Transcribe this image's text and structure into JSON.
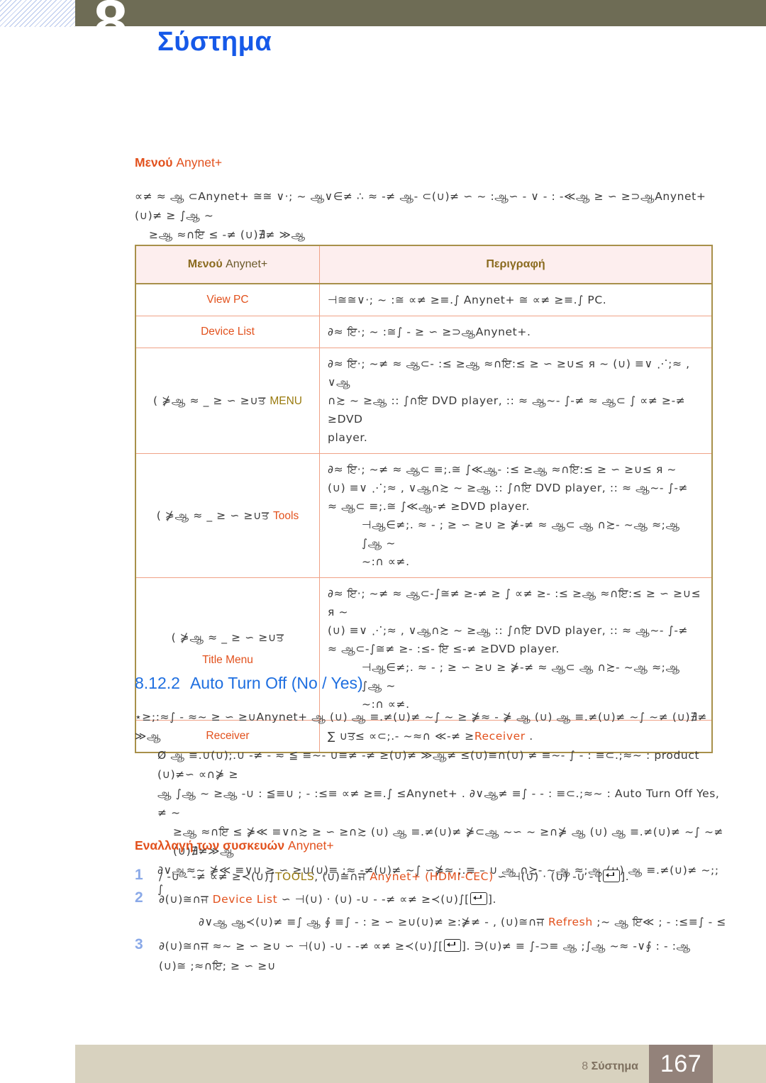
{
  "header": {
    "chapter_number": "8",
    "chapter_title": "Σύστημα"
  },
  "sections": {
    "anynet_menu_heading_bold": "Μενού",
    "anynet_menu_heading_rest": " Anynet+",
    "anynet_menu_intro_line1": "∝≠  ≈  ஆ ⊂Anynet+   ≅≅ ∨·;  ~  ஆ∨∈≠ ∴   ≈  -≠ ஆ- ⊂(∪)≠  ∽  ~  :ஆ∽ - ∨  -      : -≪ஆ   ≥  ∽  ≥⊃ஆAnynet+  (∪)≠  ≥   ∫ஆ  ~",
    "anynet_menu_intro_line2": "≥ஆ      ≈∩ਇ  ≤  -≠ (∪)∄≠ ≫ஆ",
    "auto_turn_off_number": "8.12.2",
    "auto_turn_off_title": "Auto Turn Off (No / Yes)",
    "auto_turn_off_para": "⋆≥;:≈∫ -   ≈~   ≥ ∽ ≥∪Anynet+  ஆ   (∪) ஆ ≡.≠(∪)≠ ~∫  ~  ≥ ⋡≈ -   ⋡  ஆ (∪) ஆ ≡.≠(∪)≠ ~∫   ~≠ (∪)∄≠ ≫ஆ",
    "note_line1": "Ø  ஆ ≡.∪(∪);.∪  -≠ -  ≂  ≦  ≡~- ∪≡≠ -≠ ≥(∪)≠ ≫ஆ≠ ≤(∪)≡∩(∪)  ≠ ≡~-  ∫  - : ≡⊂.;≈~ : product (∪)≠∽ ∝∩⋡ ≥",
    "note_line2": "ஆ   ∫ஆ ~ ≥ஆ -∪ : ≦≡∪  ; - :≤≡  ∝≠ ≥≡.∫  ≤Anynet+ .  ∂∨ஆ≠ ≡∫  - - : ≡⊂.;≈~ : Auto Turn Off      Yes, ≠ ~",
    "note_line3": "≥ஆ      ≈∩ਇ ≤  ⋡≪  ≡∨∩≿  ≥ ∽ ≥∩≿ (∪) ஆ ≡.≠(∪)≠ ⋡⊂ஆ  ~∽ ~ ≥∩⋡  ஆ (∪) ஆ ≡.≠(∪)≠ ~∫   ~≠ (∪)∄≠≫ஆ",
    "note_line4": "∂∨ஆ≈~  ⋡≪  ≡∨∪  ≥ ∽ ≥∪(∪)≡  ;≈ -≠(∪)≠ ~∫  ∽⋡≈    ;.≡ – ∪   ஆ ∩≿-  ~ஆ  ≈;ஆ (∪) ஆ ≡.≠(∪)≠ ~;;  ∫",
    "switch_heading_bold": "Εναλλαγή των συσκευών",
    "switch_heading_rest": " Anynet+"
  },
  "table": {
    "header_menu_bold": "Μενού",
    "header_menu_rest": " Anynet+",
    "header_description": "Περιγραφή",
    "rows": [
      {
        "label": "View PC",
        "label_pre": "",
        "label_accent": "",
        "label_accent_color": "",
        "desc": "⊣≅≅∨·; ~ :≅  ∝≠ ≥≡.∫  Anynet+     ≅  ∝≠ ≥≡.∫  PC."
      },
      {
        "label": "Device List",
        "label_pre": "",
        "label_accent": "",
        "desc": "∂≈   ਇ·; ~ :≅∫ -     ≥ ∽ ≥⊃ஆAnynet+."
      },
      {
        "label_pre": "( ⋡ஆ ≈ _  ≥ ∽ ≥∪ਤ ",
        "label_accent": "MENU",
        "label_accent_color": "gold",
        "label": "",
        "desc_line1": "∂≈   ਇ·; ~≠ ≈ ஆ⊂- :≤  ≥ஆ      ≈∩ਇ:≤  ≥ ∽ ≥∪≤ я ~ (∪)  ≡∨   ⋰;≈ ,    ∨ஆ",
        "desc_line2": "∩≿ ~ ≥ஆ  :: ∫∩ਇ  DVD player, ::    ≈   ஆ~-  ∫-≠ ≈ ஆ⊂  ∫  ∝≠ ≥-≠ ≥DVD",
        "desc_line3": "player."
      },
      {
        "label_pre": "( ⋡ஆ ≈ _  ≥ ∽ ≥∪ਤ ",
        "label_accent": "Tools",
        "label_accent_color": "orange",
        "label": "",
        "desc_line1": "∂≈   ਇ·; ~≠ ≈ ஆ⊂ ≡;.≅ ∫≪ஆ- :≤  ≥ஆ      ≈∩ਇ:≤  ≥ ∽ ≥∪≤ я ~",
        "desc_line2": "(∪)  ≡∨   ⋰;≈ ,  ∨ஆ∩≿ ~ ≥ஆ  :: ∫∩ਇ  DVD player, ::    ≈   ஆ~-  ∫-≠",
        "desc_line3": "≈ ஆ⊂ ≡;.≅ ∫≪ஆ-≠ ≥DVD player.",
        "desc_note1": "⊣ஆ∈≠;.  ≈ - ;  ≥ ∽ ≥∪  ≥ ⋡-≠ ≈ ஆ⊂ ஆ ∩≿-  ~ஆ  ≈;ஆ ∫ஆ ~",
        "desc_note2": "~:∩ ∝≠."
      },
      {
        "label_pre": "( ⋡ஆ ≈ _  ≥ ∽ ≥∪ਤ",
        "label_accent": "Title Menu",
        "label_accent_color": "orange",
        "label": "",
        "desc_line1": "∂≈   ਇ·; ~≠ ≈ ஆ⊂-∫≅≠ ≥-≠ ≥  ∫ ∝≠ ≥- :≤  ≥ஆ      ≈∩ਇ:≤  ≥ ∽ ≥∪≤ я ~",
        "desc_line2": "(∪)  ≡∨   ⋰;≈ ,  ∨ஆ∩≿ ~ ≥ஆ  :: ∫∩ਇ  DVD player, ::    ≈   ஆ~-  ∫-≠",
        "desc_line3": "≈ ஆ⊂-∫≅≠ ≥- :≤-  ਇ  ≤-≠ ≥DVD player.",
        "desc_note1": "⊣ஆ∈≠;.  ≈ - ;  ≥ ∽ ≥∪  ≥ ⋡-≠ ≈ ஆ⊂ ஆ ∩≿-  ~ஆ  ≈;ஆ ∫ஆ ~",
        "desc_note2": "~:∩ ∝≠."
      },
      {
        "label": "Receiver",
        "label_pre": "",
        "label_accent": "",
        "desc_pre": "∑ ∪ਤ≤ ∝⊂;.-  ~≈∩ ≪-≠ ≥",
        "desc_accent": "Receiver",
        "desc_post": " ."
      }
    ]
  },
  "steps": [
    {
      "number": "1",
      "pre": "/ -∪ -  -≠ ∝≠ ≥≺(∪)∫",
      "accent1": "TOOLS",
      "accent1_color": "gold",
      "mid": ",  (∪)≅∩ਜ  ",
      "accent2": "Anynet+ (HDMI-CEC)",
      "accent2_color": "orange",
      "post": "  ∽ ⊣(∪)  ⋅  (∪) -∪ -   [",
      "tail": "]."
    },
    {
      "number": "2",
      "pre": "∂(∪)≅∩ਜ  ",
      "accent1": "Device List",
      "accent1_color": "orange",
      "mid": "",
      "accent2": "",
      "post": "  ∽ ⊣(∪)  ⋅  (∪) -∪ -  -≠ ∝≠ ≥≺(∪)∫[",
      "tail": "]."
    }
  ],
  "step_note": {
    "pre": "∂∨ஆ  ஆ≺(∪)≠ ≡∫  ஆ ∮ ≡∫ - :  ≥ ∽ ≥∪(∪)≠ ≥:⋡≠ - ,  (∪)≅∩ਜ  ",
    "accent": "Refresh",
    "post": " ;~   ஆ ਇ≪  ; - :≤≡∫ -  ≤"
  },
  "step3": {
    "number": "3",
    "pre": "∂(∪)≅∩ਜ   ≈~   ≥ ∽ ≥∪ ∽ ⊣(∪) -∪ -  -≠ ∝≠ ≥≺(∪)∫[",
    "tail": "]. ∋(∪)≠ ≡ ∫-⊃≡  ஆ  ;∫ஆ ~≈ -∨∮     : - :ஆ",
    "line2": "(∪)≅  ;≈∩ਇ;  ≥ ∽ ≥∪"
  },
  "footer": {
    "label_prefix": "8 ",
    "label_bold": "Σύστημα",
    "page_number": "167"
  },
  "colors": {
    "header_bar": "#6e6c55",
    "chapter_title": "#1659e8",
    "accent_orange": "#e2511d",
    "accent_gold": "#9a7b10",
    "section_blue": "#1f6fe0",
    "table_border": "#a8904a",
    "table_inner_border": "#f0a287",
    "table_header_bg": "#fdeeee",
    "footer_bar": "#d8d2bf",
    "page_box": "#93827a",
    "step_number": "#8aa9e8"
  }
}
